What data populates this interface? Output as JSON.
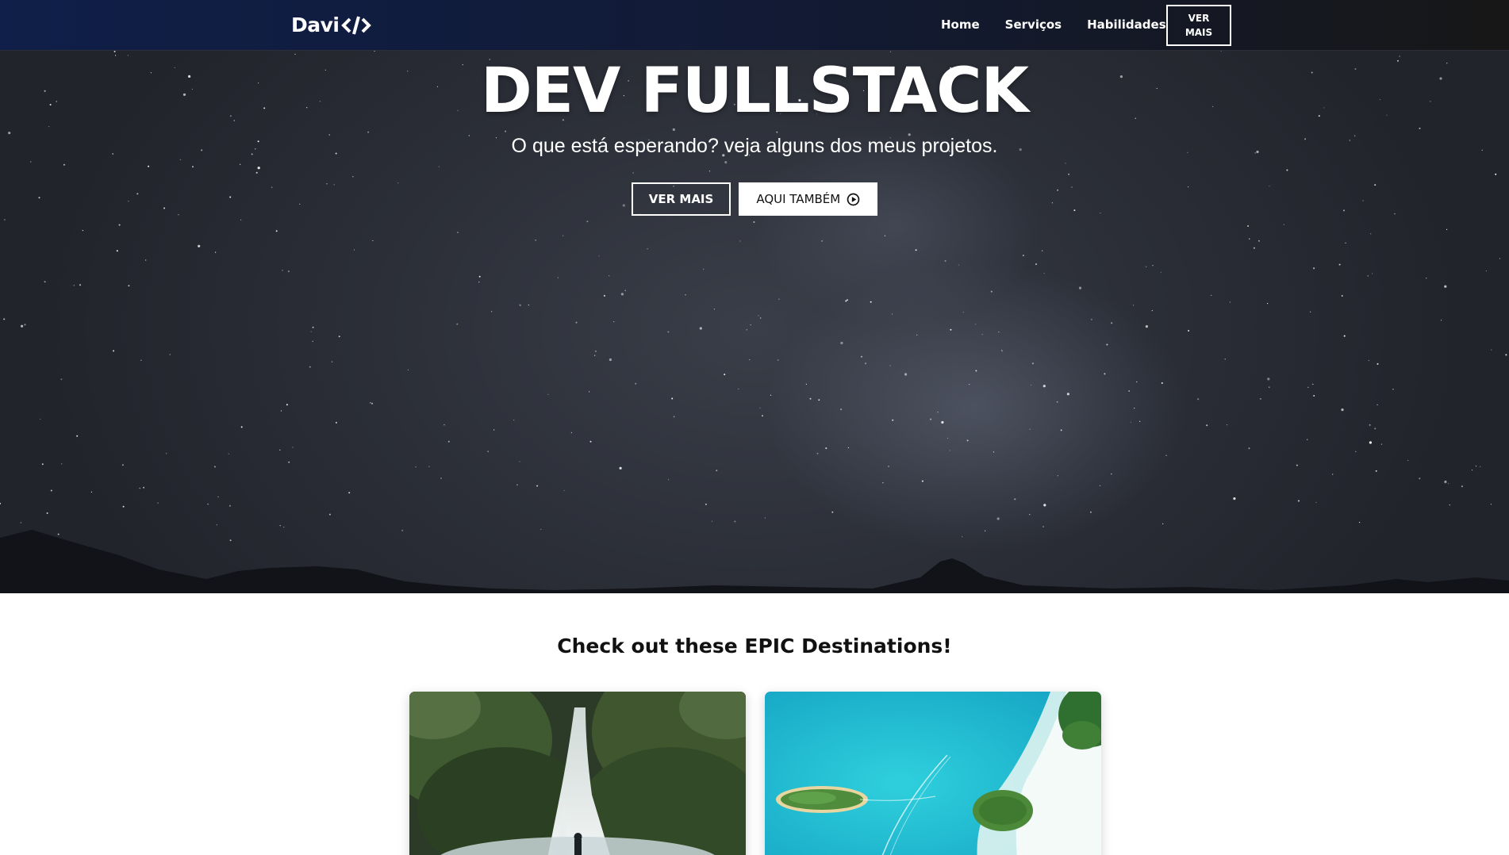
{
  "navbar": {
    "logo_text": "Davi",
    "links": [
      "Home",
      "Serviços",
      "Habilidades"
    ],
    "cta_label": "VER MAIS"
  },
  "hero": {
    "title": "DEV FULLSTACK",
    "subtitle": "O que está esperando? veja alguns dos meus projetos.",
    "primary_button": "VER MAIS",
    "secondary_button": "AQUI TAMBÉM",
    "secondary_button_icon": "play-circle-icon"
  },
  "destinations": {
    "heading": "Check out these EPIC Destinations!",
    "cards": [
      "waterfall-photo",
      "tropical-island-aerial-photo"
    ]
  },
  "colors": {
    "navbar_start": "#0f1f49",
    "navbar_end": "#171717",
    "hero_sky": "#2b2e37",
    "text_light": "#ffffff",
    "text_dark": "#111111"
  }
}
